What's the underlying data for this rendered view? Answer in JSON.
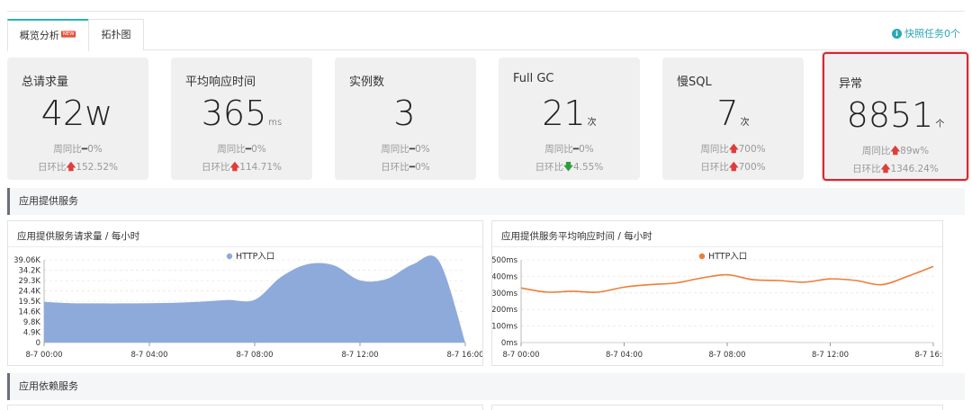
{
  "tabs": [
    {
      "label": "概览分析",
      "badge": "NEW",
      "active": true
    },
    {
      "label": "拓扑图",
      "active": false
    }
  ],
  "snapshot": {
    "label": "快照任务0个"
  },
  "cards": [
    {
      "title": "总请求量",
      "value": "42w",
      "unit": "",
      "week_label": "周同比",
      "week_trend": "flat",
      "week_value": "0%",
      "day_label": "日环比",
      "day_trend": "up",
      "day_value": "152.52%"
    },
    {
      "title": "平均响应时间",
      "value": "365",
      "unit": "ms",
      "week_label": "周同比",
      "week_trend": "flat",
      "week_value": "0%",
      "day_label": "日环比",
      "day_trend": "up",
      "day_value": "114.71%"
    },
    {
      "title": "实例数",
      "value": "3",
      "unit": "",
      "week_label": "周同比",
      "week_trend": "flat",
      "week_value": "0%",
      "day_label": "日环比",
      "day_trend": "flat",
      "day_value": "0%"
    },
    {
      "title": "Full GC",
      "value": "21",
      "unit": "次",
      "week_label": "周同比",
      "week_trend": "flat",
      "week_value": "0%",
      "day_label": "日环比",
      "day_trend": "down",
      "day_value": "4.55%"
    },
    {
      "title": "慢SQL",
      "value": "7",
      "unit": "次",
      "week_label": "周同比",
      "week_trend": "up",
      "week_value": "700%",
      "day_label": "日环比",
      "day_trend": "up",
      "day_value": "700%"
    },
    {
      "title": "异常",
      "value": "8851",
      "unit": "个",
      "week_label": "周同比",
      "week_trend": "up",
      "week_value": "89w%",
      "day_label": "日环比",
      "day_trend": "up",
      "day_value": "1346.24%",
      "highlighted": true
    }
  ],
  "sections": {
    "provided": "应用提供服务",
    "dependent": "应用依赖服务"
  },
  "colors": {
    "accent": "#2ab4b0",
    "area_fill": "#8eaadb",
    "line": "#ee7d37",
    "alert_border": "#d8262e",
    "up": "#e03c3c",
    "down": "#2f9e3a"
  },
  "chart_data": [
    {
      "type": "area",
      "title": "应用提供服务请求量 / 每小时",
      "legend": "HTTP入口",
      "series": [
        {
          "name": "HTTP入口",
          "color": "#8eaadb"
        }
      ],
      "y_ticks": [
        "0",
        "4.9K",
        "9.8K",
        "14.6K",
        "19.5K",
        "24.4K",
        "29.3K",
        "34.2K",
        "39.06K"
      ],
      "x_ticks": [
        "8-7 00:00",
        "8-7 04:00",
        "8-7 08:00",
        "8-7 12:00",
        "8-7 16:00"
      ],
      "ylim": [
        0,
        39060
      ],
      "x": [
        0,
        1,
        2,
        3,
        4,
        5,
        6,
        7,
        8,
        9,
        10,
        11,
        12,
        13,
        14,
        15,
        16
      ],
      "values": [
        19200,
        18600,
        18500,
        18500,
        18600,
        18800,
        19300,
        20100,
        20200,
        31000,
        37000,
        36500,
        29400,
        30000,
        36900,
        38500,
        0
      ]
    },
    {
      "type": "line",
      "title": "应用提供服务平均响应时间 / 每小时",
      "legend": "HTTP入口",
      "series": [
        {
          "name": "HTTP入口",
          "color": "#ee7d37"
        }
      ],
      "y_ticks": [
        "0ms",
        "100ms",
        "200ms",
        "300ms",
        "400ms",
        "500ms"
      ],
      "x_ticks": [
        "8-7 00:00",
        "8-7 04:00",
        "8-7 08:00",
        "8-7 12:00",
        "8-7 16:00"
      ],
      "ylim": [
        0,
        500
      ],
      "x": [
        0,
        1,
        2,
        3,
        4,
        5,
        6,
        7,
        8,
        9,
        10,
        11,
        12,
        13,
        14,
        15,
        16
      ],
      "values": [
        330,
        305,
        310,
        305,
        335,
        350,
        360,
        390,
        410,
        380,
        375,
        365,
        385,
        375,
        350,
        400,
        460
      ]
    }
  ]
}
